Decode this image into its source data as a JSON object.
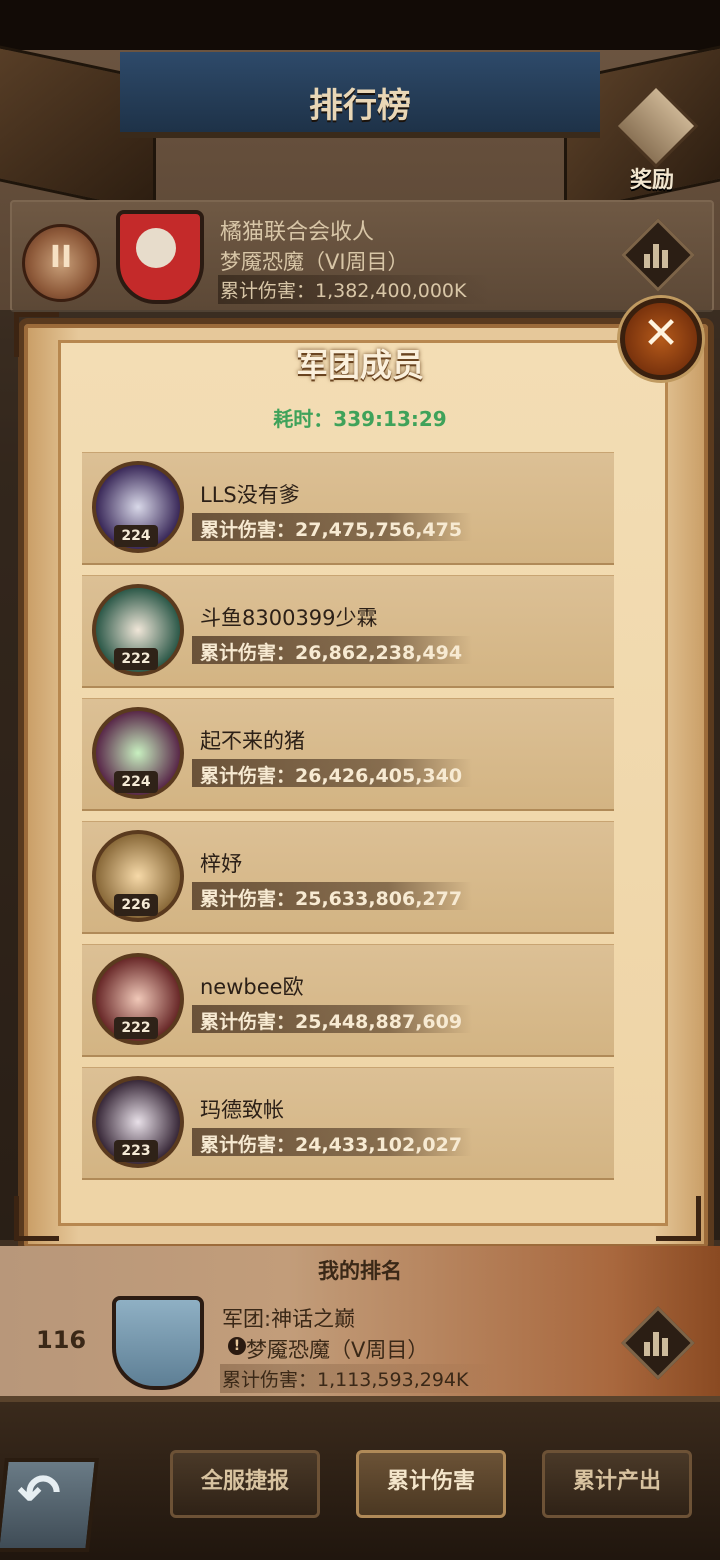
{
  "header": {
    "title": "排行榜",
    "reward_label": "奖励"
  },
  "top_entry": {
    "rank_display": "II",
    "guild_name": "橘猫联合会收人",
    "boss": "梦魇恐魔（VI周目）",
    "damage": "累计伤害：1,382,400,000K"
  },
  "modal": {
    "title": "军团成员",
    "elapsed_label": "耗时：",
    "elapsed_value": "339:13:29",
    "close_glyph": "✕",
    "members": [
      {
        "name": "LLS没有爹",
        "damage": "累计伤害：27,475,756,475",
        "level": "224",
        "avatar_color": "#3b2a5a"
      },
      {
        "name": "斗鱼8300399少霖",
        "damage": "累计伤害：26,862,238,494",
        "level": "222",
        "avatar_color": "#2e5a4a"
      },
      {
        "name": "起不来的猪",
        "damage": "累计伤害：26,426,405,340",
        "level": "224",
        "avatar_color": "#5a2a4a"
      },
      {
        "name": "梓妤",
        "damage": "累计伤害：25,633,806,277",
        "level": "226",
        "avatar_color": "#8a6a3a"
      },
      {
        "name": "newbee欧",
        "damage": "累计伤害：25,448,887,609",
        "level": "222",
        "avatar_color": "#6a2a2a"
      },
      {
        "name": "玛德致帐",
        "damage": "累计伤害：24,433,102,027",
        "level": "223",
        "avatar_color": "#3a2a3a"
      }
    ]
  },
  "my_rank": {
    "header": "我的排名",
    "rank": "116",
    "guild": "军团:神话之巅",
    "warn_glyph": "!",
    "boss": "梦魇恐魔（V周目）",
    "damage": "累计伤害：1,113,593,294K"
  },
  "bottom_tabs": [
    {
      "label": "全服捷报"
    },
    {
      "label": "累计伤害"
    },
    {
      "label": "累计产出"
    }
  ],
  "back_glyph": "↶",
  "colors": {
    "accent_green": "#3fa25a",
    "emblem_red": "#c42a2a",
    "parchment": "#f3ddb4"
  }
}
